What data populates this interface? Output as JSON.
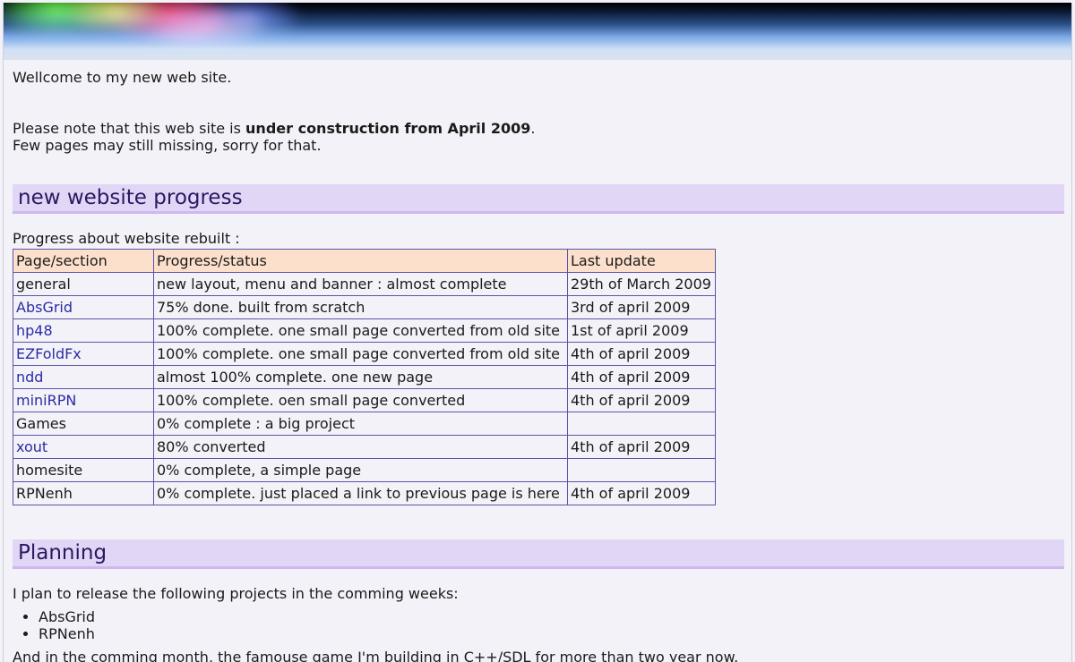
{
  "page": {
    "welcome": "Wellcome to my new web site.",
    "notice": {
      "prefix": "Please note that this web site is ",
      "bold": "under construction from April 2009",
      "suffix": ".",
      "line2": "Few pages may still missing, sorry for that."
    }
  },
  "progress": {
    "heading": "new website progress",
    "intro": "Progress about website rebuilt :",
    "columns": [
      "Page/section",
      "Progress/status",
      "Last update"
    ],
    "rows": [
      {
        "page": "general",
        "link": false,
        "status": "new layout, menu and banner : almost complete",
        "date": "29th of March 2009"
      },
      {
        "page": "AbsGrid",
        "link": true,
        "status": "75% done. built from scratch",
        "date": "3rd of april 2009"
      },
      {
        "page": "hp48",
        "link": true,
        "status": "100% complete. one small page converted from old site",
        "date": "1st of april 2009"
      },
      {
        "page": "EZFoldFx",
        "link": true,
        "status": "100% complete. one small page converted from old site",
        "date": "4th of april 2009"
      },
      {
        "page": "ndd",
        "link": true,
        "status": "almost 100% complete. one new page",
        "date": "4th of april 2009"
      },
      {
        "page": "miniRPN",
        "link": true,
        "status": "100% complete. oen small page converted",
        "date": "4th of april 2009"
      },
      {
        "page": "Games",
        "link": false,
        "status": "0% complete : a big project",
        "date": ""
      },
      {
        "page": "xout",
        "link": true,
        "status": "80% converted",
        "date": "4th of april 2009"
      },
      {
        "page": "homesite",
        "link": false,
        "status": "0% complete, a simple page",
        "date": ""
      },
      {
        "page": "RPNenh",
        "link": false,
        "status": "0% complete. just placed a link to previous page is here",
        "date": "4th of april 2009"
      }
    ]
  },
  "planning": {
    "heading": "Planning",
    "intro": "I plan to release the following projects in the comming weeks:",
    "items": [
      "AbsGrid",
      "RPNenh"
    ],
    "more": "And in the comming month, the famouse game I'm building in C++/SDL for more than two year now."
  },
  "colors": {
    "background": "#f3f2f8",
    "heading_bg": "#e2d6f7",
    "heading_text": "#2a1860",
    "table_header_bg": "#fde0cc",
    "table_border": "#5a55a8",
    "link": "#2b2ba8"
  }
}
